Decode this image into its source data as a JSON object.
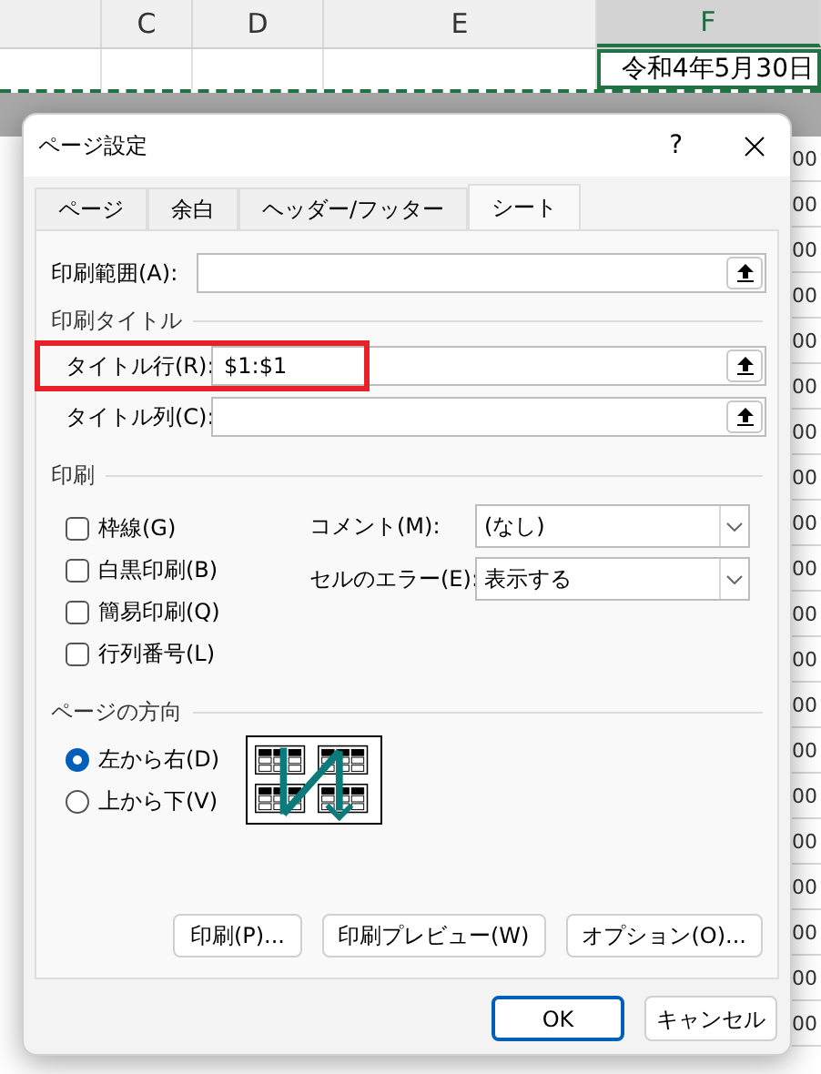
{
  "sheet": {
    "column_headers": [
      {
        "label": "C",
        "selected": false
      },
      {
        "label": "D",
        "selected": false
      },
      {
        "label": "E",
        "selected": false
      },
      {
        "label": "F",
        "selected": true
      }
    ],
    "date_cell": "令和4年5月30日",
    "right_column_cells": [
      "00",
      "00",
      "00",
      "00",
      "00",
      "00",
      "00",
      "00",
      "00",
      "00",
      "00",
      "00",
      "00",
      "00",
      "00",
      "00",
      "00",
      "00",
      "00",
      "00"
    ]
  },
  "dialog": {
    "title": "ページ設定",
    "help": "?",
    "tabs": [
      {
        "label": "ページ",
        "selected": false
      },
      {
        "label": "余白",
        "selected": false
      },
      {
        "label": "ヘッダー/フッター",
        "selected": false
      },
      {
        "label": "シート",
        "selected": true
      }
    ],
    "print_area": {
      "label": "印刷範囲(A):"
    },
    "print_titles": {
      "heading": "印刷タイトル",
      "title_rows": {
        "label": "タイトル行(R):",
        "value": "$1:$1",
        "highlighted": true
      },
      "title_columns": {
        "label": "タイトル列(C):"
      }
    },
    "print": {
      "heading": "印刷",
      "checkboxes": [
        {
          "label": "枠線(G)",
          "checked": false
        },
        {
          "label": "白黒印刷(B)",
          "checked": false
        },
        {
          "label": "簡易印刷(Q)",
          "checked": false
        },
        {
          "label": "行列番号(L)",
          "checked": false
        }
      ],
      "dropdowns": [
        {
          "label": "コメント(M):",
          "value": "(なし)"
        },
        {
          "label": "セルのエラー(E):",
          "value": "表示する"
        }
      ]
    },
    "page_order": {
      "heading": "ページの方向",
      "options": [
        {
          "label": "左から右(D)",
          "selected": true
        },
        {
          "label": "上から下(V)",
          "selected": false
        }
      ]
    },
    "buttons": [
      "印刷(P)...",
      "印刷プレビュー(W)",
      "オプション(O)..."
    ],
    "footer_buttons": [
      {
        "label": "OK",
        "kind": "default"
      },
      {
        "label": "キャンセル",
        "kind": "normal"
      }
    ]
  }
}
